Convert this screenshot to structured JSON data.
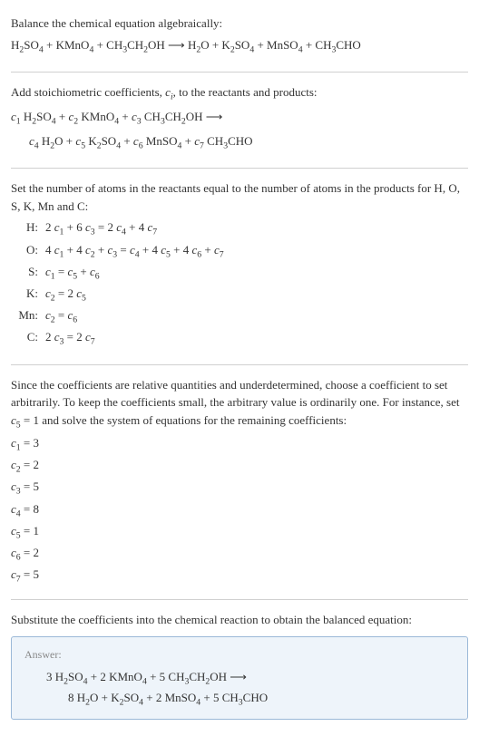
{
  "header": {
    "title": "Balance the chemical equation algebraically:",
    "equation": "H₂SO₄ + KMnO₄ + CH₃CH₂OH ⟶ H₂O + K₂SO₄ + MnSO₄ + CH₃CHO"
  },
  "stoich": {
    "intro": "Add stoichiometric coefficients, cᵢ, to the reactants and products:",
    "line1": "c₁ H₂SO₄ + c₂ KMnO₄ + c₃ CH₃CH₂OH ⟶",
    "line2": "c₄ H₂O + c₅ K₂SO₄ + c₆ MnSO₄ + c₇ CH₃CHO"
  },
  "atoms": {
    "intro": "Set the number of atoms in the reactants equal to the number of atoms in the products for H, O, S, K, Mn and C:",
    "rows": [
      {
        "el": "H:",
        "eq": "2 c₁ + 6 c₃ = 2 c₄ + 4 c₇"
      },
      {
        "el": "O:",
        "eq": "4 c₁ + 4 c₂ + c₃ = c₄ + 4 c₅ + 4 c₆ + c₇"
      },
      {
        "el": "S:",
        "eq": "c₁ = c₅ + c₆"
      },
      {
        "el": "K:",
        "eq": "c₂ = 2 c₅"
      },
      {
        "el": "Mn:",
        "eq": "c₂ = c₆"
      },
      {
        "el": "C:",
        "eq": "2 c₃ = 2 c₇"
      }
    ]
  },
  "solve": {
    "intro": "Since the coefficients are relative quantities and underdetermined, choose a coefficient to set arbitrarily. To keep the coefficients small, the arbitrary value is ordinarily one. For instance, set c₅ = 1 and solve the system of equations for the remaining coefficients:",
    "coeffs": [
      "c₁ = 3",
      "c₂ = 2",
      "c₃ = 5",
      "c₄ = 8",
      "c₅ = 1",
      "c₆ = 2",
      "c₇ = 5"
    ]
  },
  "result": {
    "intro": "Substitute the coefficients into the chemical reaction to obtain the balanced equation:",
    "answer_label": "Answer:",
    "line1": "3 H₂SO₄ + 2 KMnO₄ + 5 CH₃CH₂OH ⟶",
    "line2": "8 H₂O + K₂SO₄ + 2 MnSO₄ + 5 CH₃CHO"
  },
  "chart_data": {
    "type": "table",
    "title": "Balanced chemical equation coefficients",
    "reactants": {
      "H2SO4": 3,
      "KMnO4": 2,
      "CH3CH2OH": 5
    },
    "products": {
      "H2O": 8,
      "K2SO4": 1,
      "MnSO4": 2,
      "CH3CHO": 5
    },
    "atom_balance": {
      "H": "2c1 + 6c3 = 2c4 + 4c7",
      "O": "4c1 + 4c2 + c3 = c4 + 4c5 + 4c6 + c7",
      "S": "c1 = c5 + c6",
      "K": "c2 = 2c5",
      "Mn": "c2 = c6",
      "C": "2c3 = 2c7"
    }
  }
}
